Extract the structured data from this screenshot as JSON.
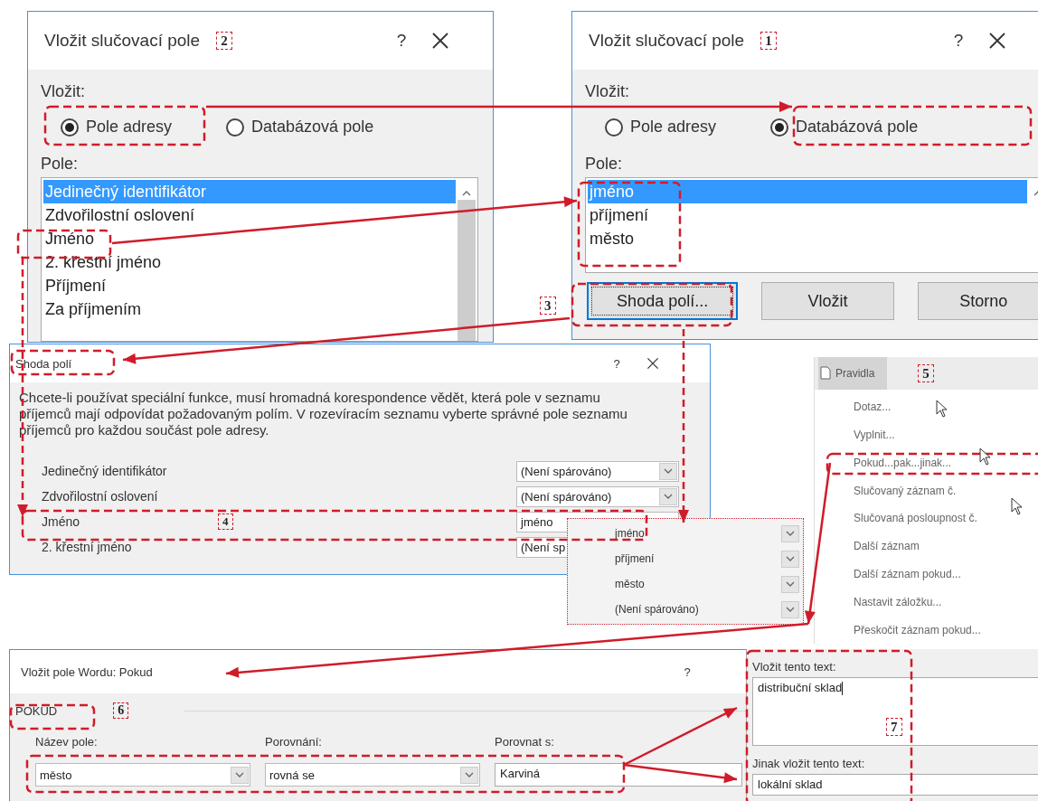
{
  "address_dialog": {
    "title": "Vložit slučovací pole",
    "callout": "2",
    "help": "?",
    "insert_label": "Vložit:",
    "options": [
      {
        "label": "Pole adresy",
        "selected": true
      },
      {
        "label": "Databázová pole",
        "selected": false
      }
    ],
    "fields_label": "Pole:",
    "fields": [
      {
        "label": "Jedinečný identifikátor",
        "selected": true
      },
      {
        "label": "Zdvořilostní oslovení",
        "selected": false
      },
      {
        "label": "Jméno",
        "selected": false
      },
      {
        "label": "2. křestní jméno",
        "selected": false
      },
      {
        "label": "Příjmení",
        "selected": false
      },
      {
        "label": "Za příjmením",
        "selected": false
      }
    ]
  },
  "database_dialog": {
    "title": "Vložit slučovací pole",
    "callout": "1",
    "help": "?",
    "insert_label": "Vložit:",
    "options": [
      {
        "label": "Pole adresy",
        "selected": false
      },
      {
        "label": "Databázová pole",
        "selected": true
      }
    ],
    "fields_label": "Pole:",
    "fields": [
      {
        "label": "jméno",
        "selected": true
      },
      {
        "label": "příjmení",
        "selected": false
      },
      {
        "label": "město",
        "selected": false
      }
    ],
    "buttons": [
      {
        "label": "Shoda polí...",
        "focused": true
      },
      {
        "label": "Vložit",
        "focused": false
      },
      {
        "label": "Storno",
        "focused": false
      }
    ],
    "button_callout": "3"
  },
  "match_dialog": {
    "title": "Shoda polí",
    "help": "?",
    "description": "Chcete-li používat speciální funkce, musí hromadná korespondence vědět, která pole v seznamu příjemců mají odpovídat požadovaným polím. V rozevíracím seznamu vyberte správné pole seznamu příjemců pro každou součást pole adresy.",
    "callout": "4",
    "rows": [
      {
        "label": "Jedinečný identifikátor",
        "value": "(Není spárováno)"
      },
      {
        "label": "Zdvořilostní oslovení",
        "value": "(Není spárováno)"
      },
      {
        "label": "Jméno",
        "value": "jméno"
      },
      {
        "label": "2. křestní jméno",
        "value": "(Není sp"
      }
    ]
  },
  "dropdown": {
    "items": [
      "jméno",
      "příjmení",
      "město",
      "(Není spárováno)"
    ]
  },
  "rules_menu": {
    "title": "Pravidla",
    "callout": "5",
    "items": [
      "Dotaz...",
      "Vyplnit...",
      "Pokud...pak...jinak...",
      "Slučovaný záznam č.",
      "Slučovaná posloupnost č.",
      "Další záznam",
      "Další záznam pokud...",
      "Nastavit záložku...",
      "Přeskočit záznam pokud..."
    ]
  },
  "if_dialog": {
    "title": "Vložit pole Wordu: Pokud",
    "help": "?",
    "group": "POKUD",
    "callout": "6",
    "field_name": {
      "label": "Název pole:",
      "value": "město"
    },
    "comparison": {
      "label": "Porovnání:",
      "value": "rovná se"
    },
    "compare_with": {
      "label": "Porovnat s:",
      "value": "Karviná"
    },
    "then_text": {
      "label": "Vložit tento text:",
      "value": "distribuční sklad"
    },
    "else_text": {
      "label": "Jinak vložit tento text:",
      "value": "lokální sklad"
    },
    "text_callout": "7"
  }
}
